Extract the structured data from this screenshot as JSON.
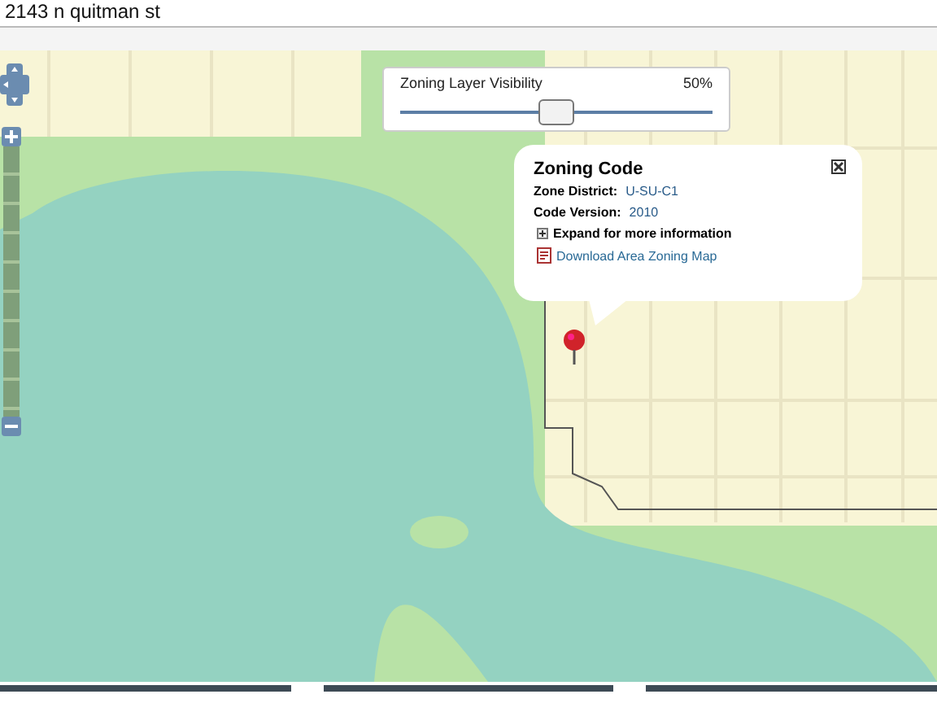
{
  "address": "2143 n quitman st",
  "visibility": {
    "label": "Zoning Layer Visibility",
    "reading": "50%",
    "level": 0.5
  },
  "popup": {
    "title": "Zoning Code",
    "fields": [
      {
        "label": "Zone District:",
        "value": "U-SU-C1"
      },
      {
        "label": "Code Version:",
        "value": "2010"
      }
    ],
    "expand": "Expand for more information",
    "download": "Download Area Zoning Map"
  }
}
